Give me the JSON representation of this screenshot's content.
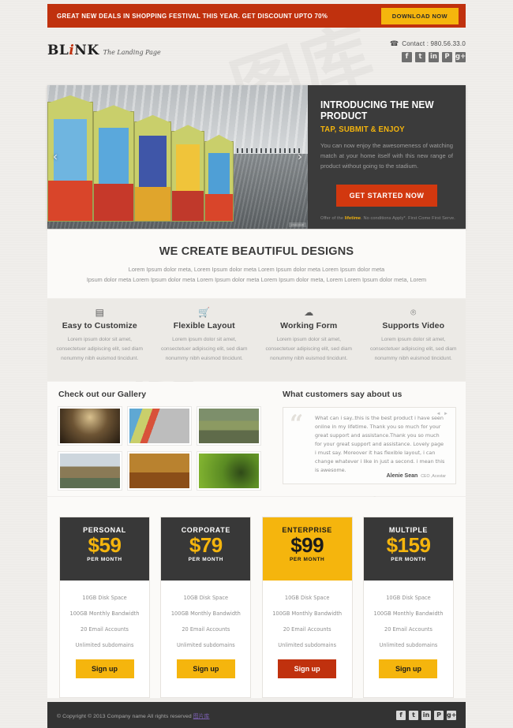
{
  "promo": {
    "text": "GREAT NEW DEALS IN SHOPPING FESTIVAL THIS YEAR. GET DISCOUNT UPTO 70%",
    "button": "DOWNLOAD NOW"
  },
  "header": {
    "logo_pre": "BL",
    "logo_i": "i",
    "logo_post": "NK",
    "tagline": "The Landing Page",
    "phone_icon": "☎",
    "contact": "Contact : 980.56.33.0",
    "socials": [
      {
        "name": "facebook-icon",
        "glyph": "f"
      },
      {
        "name": "twitter-icon",
        "glyph": "t"
      },
      {
        "name": "linkedin-icon",
        "glyph": "in"
      },
      {
        "name": "pinterest-icon",
        "glyph": "P"
      },
      {
        "name": "googleplus-icon",
        "glyph": "g+"
      }
    ]
  },
  "hero": {
    "prev_icon": "‹",
    "next_icon": "›",
    "caption": "photo credit",
    "title": "INTRODUCING THE NEW PRODUCT",
    "subtitle": "TAP, SUBMIT & ENJOY",
    "body": "You can now enjoy the awesomeness of watching match at your home itself with this new range of product without going to the stadium.",
    "cta": "GET STARTED NOW",
    "footnote_pre": "Offer of the ",
    "footnote_strong": "lifetime",
    "footnote_post": ". No conditions Apply*. First Come First Serve."
  },
  "intro": {
    "title": "WE CREATE BEAUTIFUL DESIGNS",
    "line1": "Lorem Ipsum dolor meta, Lorem Ipsum dolor meta Lorem Ipsum dolor meta Lorem Ipsum dolor meta",
    "line2": "Ipsum dolor meta Lorem Ipsum dolor meta Lorem Ipsum dolor meta Lorem Ipsum dolor meta, Lorem Lorem Ipsum dolor meta, Lorem"
  },
  "features": [
    {
      "icon": "comment-icon",
      "glyph": "▤",
      "title": "Easy to Customize",
      "text": "Lorem ipsum dolor sit amet, consectetuer adipiscing elit, sed diam nonummy nibh euismod tincidunt."
    },
    {
      "icon": "shopping-cart-icon",
      "glyph": "🛒",
      "title": "Flexible Layout",
      "text": "Lorem ipsum dolor sit amet, consectetuer adipiscing elit, sed diam nonummy nibh euismod tincidunt."
    },
    {
      "icon": "cloud-icon",
      "glyph": "☁",
      "title": "Working Form",
      "text": "Lorem ipsum dolor sit amet, consectetuer adipiscing elit, sed diam nonummy nibh euismod tincidunt."
    },
    {
      "icon": "broadcast-signal-icon",
      "glyph": "⌾",
      "title": "Supports Video",
      "text": "Lorem ipsum dolor sit amet, consectetuer adipiscing elit, sed diam nonummy nibh euismod tincidunt."
    }
  ],
  "gallery": {
    "title": "Check out our Gallery",
    "items": [
      {
        "name": "gallery-thumb-crowd"
      },
      {
        "name": "gallery-thumb-beach-huts"
      },
      {
        "name": "gallery-thumb-cyclists"
      },
      {
        "name": "gallery-thumb-road-bubbles"
      },
      {
        "name": "gallery-thumb-gallery-room"
      },
      {
        "name": "gallery-thumb-green-abstract"
      }
    ]
  },
  "testimonial": {
    "title": "What customers say about us",
    "quote_glyph": "“",
    "nav": "◄ ►",
    "text": "What can i say..this is the best product i have seen online in my lifetime. Thank you so much for your great support and assistance.Thank you so much for your great support and assistance. Lovely page i must say. Moreover it has flexible layout, i can change whatever i like in just a second. i mean this is awesome.",
    "author": "Alenie Sean",
    "role": "CEO ,Acestar"
  },
  "pricing": {
    "plans": [
      {
        "name": "PERSONAL",
        "price": "$59",
        "per": "PER MONTH",
        "highlight": false,
        "button_style": "yellow",
        "features": [
          "10GB Disk Space",
          "100GB Monthly Bandwidth",
          "20 Email Accounts",
          "Unlimited subdomains"
        ],
        "button": "Sign up"
      },
      {
        "name": "CORPORATE",
        "price": "$79",
        "per": "PER MONTH",
        "highlight": false,
        "button_style": "yellow",
        "features": [
          "10GB Disk Space",
          "100GB Monthly Bandwidth",
          "20 Email Accounts",
          "Unlimited subdomains"
        ],
        "button": "Sign up"
      },
      {
        "name": "ENTERPRISE",
        "price": "$99",
        "per": "PER MONTH",
        "highlight": true,
        "button_style": "red",
        "features": [
          "10GB Disk Space",
          "100GB Monthly Bandwidth",
          "20 Email Accounts",
          "Unlimited subdomains"
        ],
        "button": "Sign up"
      },
      {
        "name": "MULTIPLE",
        "price": "$159",
        "per": "PER MONTH",
        "highlight": false,
        "button_style": "yellow",
        "features": [
          "10GB Disk Space",
          "100GB Monthly Bandwidth",
          "20 Email Accounts",
          "Unlimited subdomains"
        ],
        "button": "Sign up"
      }
    ]
  },
  "footer": {
    "copyright": "© Copyright © 2013 Company name All rights reserved ",
    "link": "图片库",
    "socials": [
      {
        "name": "facebook-icon",
        "glyph": "f"
      },
      {
        "name": "twitter-icon",
        "glyph": "t"
      },
      {
        "name": "linkedin-icon",
        "glyph": "in"
      },
      {
        "name": "pinterest-icon",
        "glyph": "P"
      },
      {
        "name": "googleplus-icon",
        "glyph": "g+"
      }
    ]
  },
  "colors": {
    "promo_red": "#c0310e",
    "accent_yellow": "#f5b50d",
    "cta_red": "#d2380f",
    "dark": "#383838",
    "page_bg": "#f0eeeb"
  }
}
